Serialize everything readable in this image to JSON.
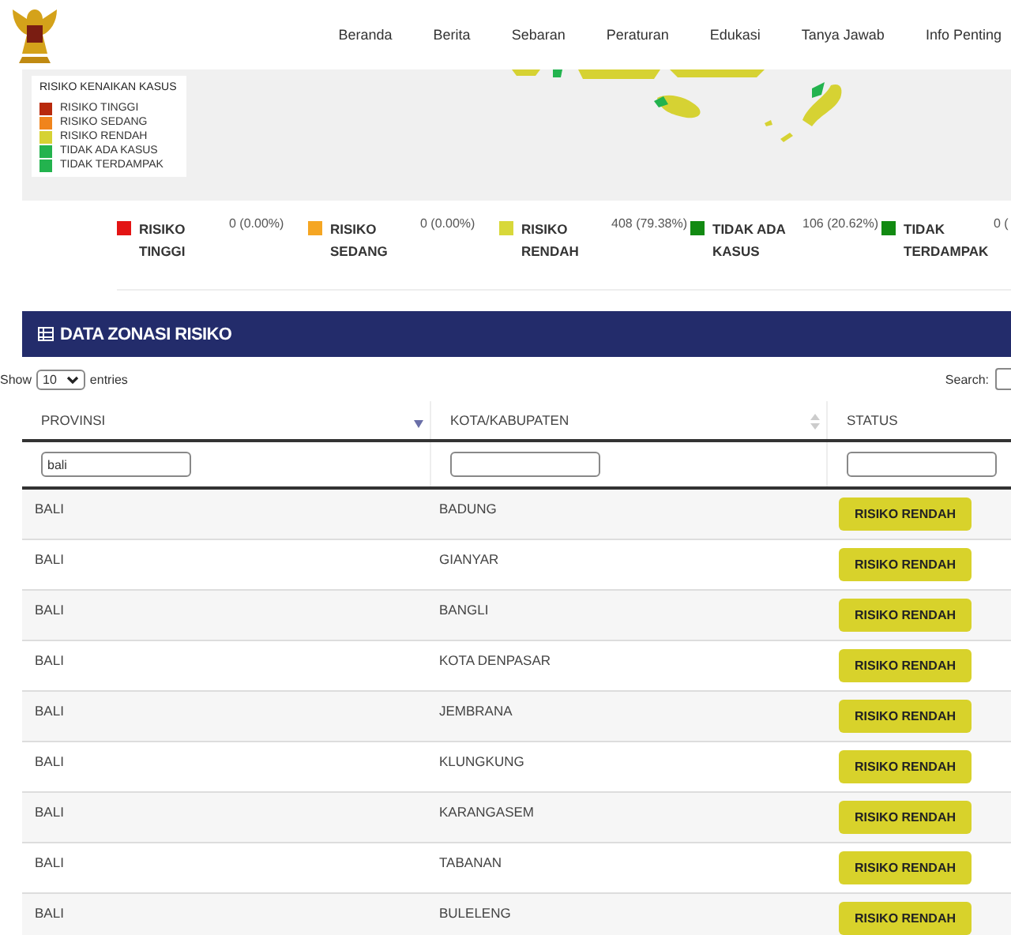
{
  "nav": {
    "items": [
      {
        "label": "Beranda"
      },
      {
        "label": "Berita"
      },
      {
        "label": "Sebaran"
      },
      {
        "label": "Peraturan"
      },
      {
        "label": "Edukasi"
      },
      {
        "label": "Tanya Jawab"
      },
      {
        "label": "Info Penting"
      }
    ]
  },
  "map": {
    "legend": {
      "title": "RISIKO KENAIKAN KASUS",
      "items": [
        {
          "label": "RISIKO TINGGI",
          "color": "#b8290c"
        },
        {
          "label": "RISIKO SEDANG",
          "color": "#f0841c"
        },
        {
          "label": "RISIKO RENDAH",
          "color": "#d6d233"
        },
        {
          "label": "TIDAK ADA KASUS",
          "color": "#23b34e"
        },
        {
          "label": "TIDAK TERDAMPAK",
          "color": "#23b34e"
        }
      ]
    }
  },
  "summary": [
    {
      "label": "RISIKO TINGGI",
      "value": "0 (0.00%)",
      "color": "#e31414"
    },
    {
      "label": "RISIKO SEDANG",
      "value": "0 (0.00%)",
      "color": "#f5a623"
    },
    {
      "label": "RISIKO RENDAH",
      "value": "408 (79.38%)",
      "color": "#d8d83a"
    },
    {
      "label": "TIDAK ADA KASUS",
      "value": "106 (20.62%)",
      "color": "#128a12"
    },
    {
      "label": "TIDAK TERDAMPAK",
      "value": "0 (",
      "color": "#128a12"
    }
  ],
  "panel": {
    "title": "DATA ZONASI RISIKO"
  },
  "table_controls": {
    "show_label": "Show",
    "page_size": "10",
    "entries_label": "entries",
    "search_label": "Search:"
  },
  "table": {
    "columns": [
      {
        "label": "PROVINSI",
        "sortable": true,
        "sorted": true,
        "filter": "bali"
      },
      {
        "label": "KOTA/KABUPATEN",
        "sortable": true,
        "sorted": false
      },
      {
        "label": "STATUS",
        "sortable": false
      }
    ],
    "rows": [
      {
        "provinsi": "BALI",
        "kota": "BADUNG",
        "status": "RISIKO RENDAH"
      },
      {
        "provinsi": "BALI",
        "kota": "GIANYAR",
        "status": "RISIKO RENDAH"
      },
      {
        "provinsi": "BALI",
        "kota": "BANGLI",
        "status": "RISIKO RENDAH"
      },
      {
        "provinsi": "BALI",
        "kota": "KOTA DENPASAR",
        "status": "RISIKO RENDAH"
      },
      {
        "provinsi": "BALI",
        "kota": "JEMBRANA",
        "status": "RISIKO RENDAH"
      },
      {
        "provinsi": "BALI",
        "kota": "KLUNGKUNG",
        "status": "RISIKO RENDAH"
      },
      {
        "provinsi": "BALI",
        "kota": "KARANGASEM",
        "status": "RISIKO RENDAH"
      },
      {
        "provinsi": "BALI",
        "kota": "TABANAN",
        "status": "RISIKO RENDAH"
      },
      {
        "provinsi": "BALI",
        "kota": "BULELENG",
        "status": "RISIKO RENDAH"
      }
    ]
  }
}
